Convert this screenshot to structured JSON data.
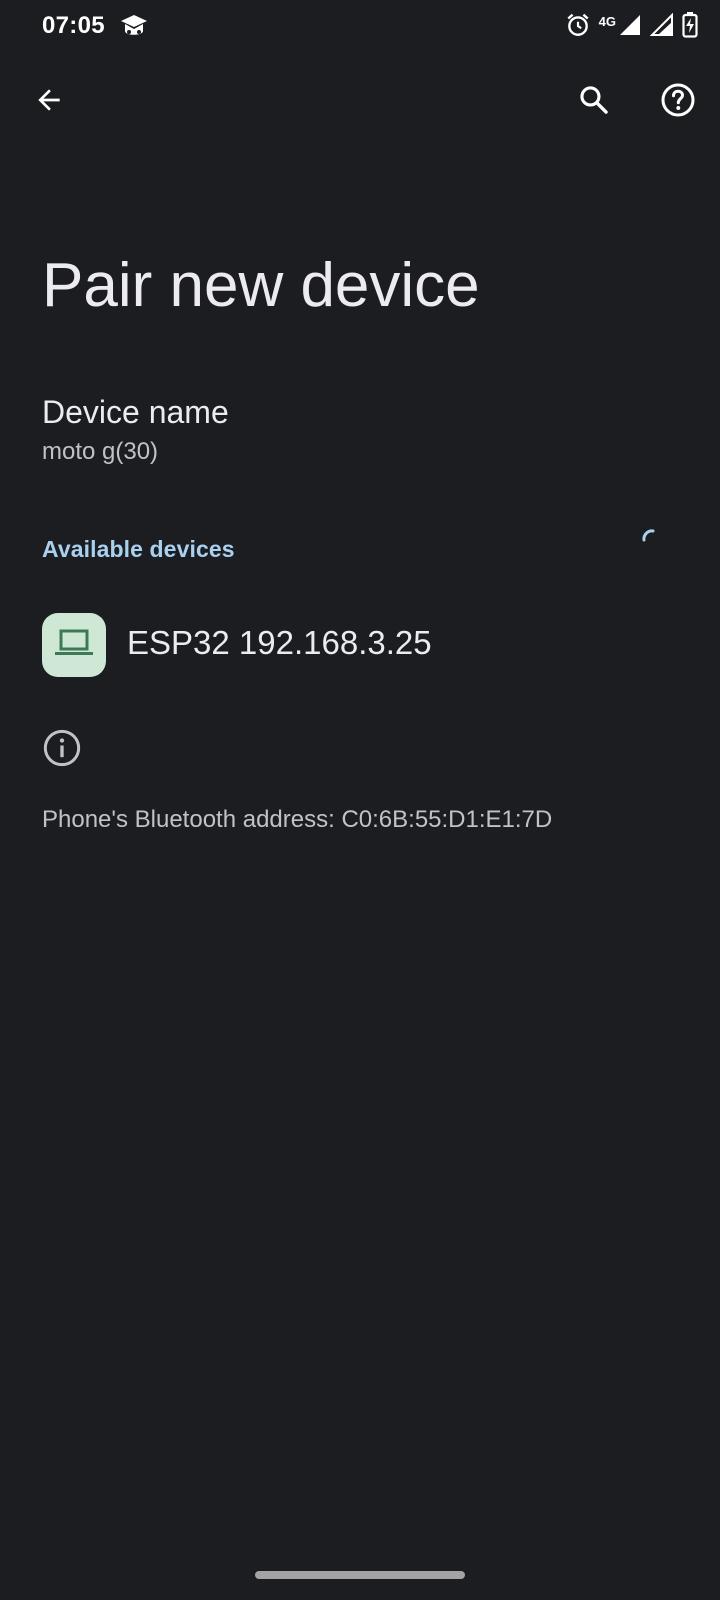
{
  "status_bar": {
    "time": "07:05",
    "network": "4G",
    "icons": [
      "app-notification-icon",
      "alarm-icon",
      "signal-icon",
      "signal-icon",
      "battery-charging-icon"
    ]
  },
  "app_bar": {
    "icons": [
      "back-arrow-icon",
      "search-icon",
      "help-icon"
    ]
  },
  "page": {
    "title": "Pair new device"
  },
  "device_name": {
    "title": "Device name",
    "summary": "moto g(30)"
  },
  "available_devices": {
    "header": "Available devices",
    "items": [
      {
        "label": "ESP32 192.168.3.25",
        "icon": "laptop-icon"
      }
    ]
  },
  "info": {
    "icon": "info-icon",
    "bluetooth_address": "Phone's Bluetooth address: C0:6B:55:D1:E1:7D"
  },
  "colors": {
    "background": "#1c1d21",
    "accent": "#a9d1ef",
    "device_icon_bg": "#cfe8d6",
    "device_icon_fg": "#3c7a57",
    "text_primary": "#ecebef",
    "text_secondary": "#c2c1c9"
  }
}
